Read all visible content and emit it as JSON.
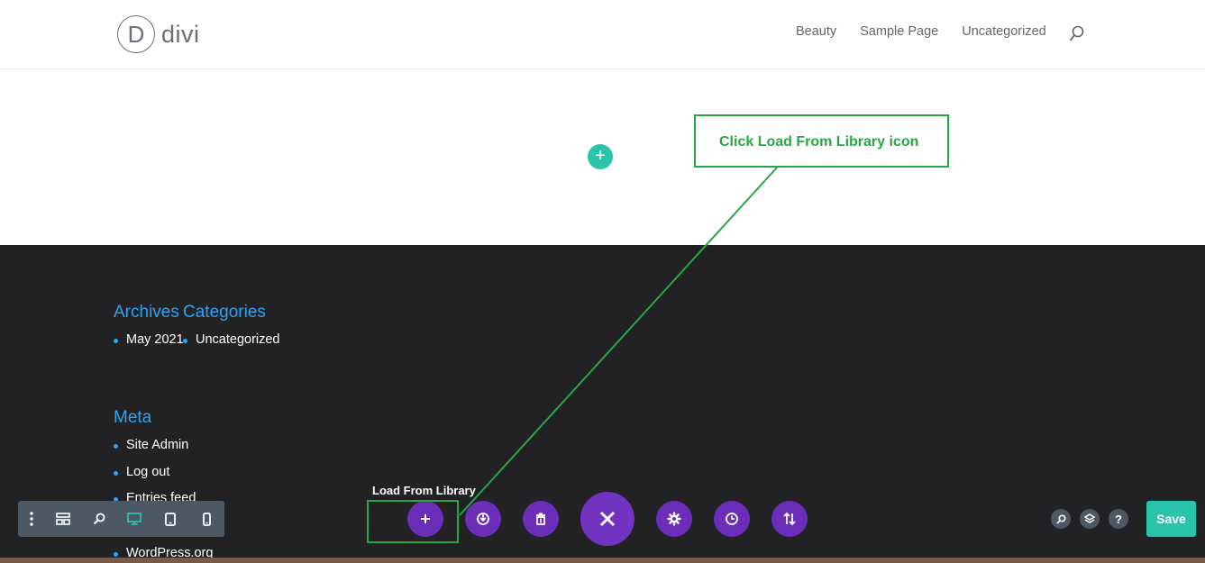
{
  "header": {
    "logo_letter": "D",
    "logo_text": "divi",
    "nav": [
      "Beauty",
      "Sample Page",
      "Uncategorized"
    ]
  },
  "annotation": {
    "callout_text": "Click Load From Library icon",
    "accent_color": "#27a844"
  },
  "footer": {
    "archives_title": "Archives",
    "categories_title": "Categories",
    "archives_items": [
      "May 2021"
    ],
    "categories_items": [
      "Uncategorized"
    ],
    "meta_title": "Meta",
    "meta_items": [
      "Site Admin",
      "Log out",
      "Entries feed",
      "WordPress.org"
    ]
  },
  "builder": {
    "tooltip": "Load From Library",
    "save_label": "Save",
    "help_label": "?",
    "left_icons": [
      "more-options-icon",
      "wireframe-view-icon",
      "zoom-icon",
      "desktop-view-icon",
      "tablet-view-icon",
      "phone-view-icon"
    ],
    "center_icons": [
      "add-from-library-icon",
      "portability-icon",
      "clear-layout-icon",
      "close-icon",
      "page-settings-icon",
      "history-icon",
      "portability-sort-icon"
    ],
    "right_icons": [
      "search-icon",
      "layers-icon",
      "help-icon"
    ]
  },
  "colors": {
    "brand_purple": "#6c2eb9",
    "teal": "#29c4a9",
    "link_blue": "#2ea3f2",
    "footer_bg": "#222224"
  }
}
